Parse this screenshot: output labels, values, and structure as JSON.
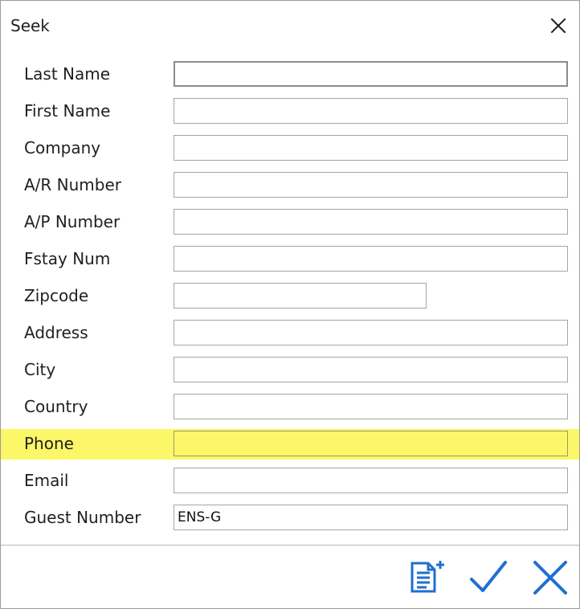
{
  "window": {
    "title": "Seek"
  },
  "fields": [
    {
      "label": "Last Name",
      "value": "",
      "placeholder": ""
    },
    {
      "label": "First Name",
      "value": "",
      "placeholder": ""
    },
    {
      "label": "Company",
      "value": "",
      "placeholder": ""
    },
    {
      "label": "A/R Number",
      "value": "",
      "placeholder": ""
    },
    {
      "label": "A/P Number",
      "value": "",
      "placeholder": ""
    },
    {
      "label": "Fstay Num",
      "value": "",
      "placeholder": ""
    },
    {
      "label": "Zipcode",
      "value": "",
      "placeholder": ""
    },
    {
      "label": "Address",
      "value": "",
      "placeholder": ""
    },
    {
      "label": "City",
      "value": "",
      "placeholder": ""
    },
    {
      "label": "Country",
      "value": "",
      "placeholder": ""
    },
    {
      "label": "Phone",
      "value": "",
      "placeholder": ""
    },
    {
      "label": "Email",
      "value": "",
      "placeholder": ""
    },
    {
      "label": "Guest Number",
      "value": "ENS-G",
      "placeholder": ""
    }
  ],
  "icons": {
    "close": "close-icon",
    "add_list": "add-list-icon",
    "ok": "checkmark-icon",
    "cancel": "cancel-icon"
  },
  "colors": {
    "highlight": "#fbf768",
    "accent": "#1f6fd1",
    "border": "#a5a5a5"
  }
}
